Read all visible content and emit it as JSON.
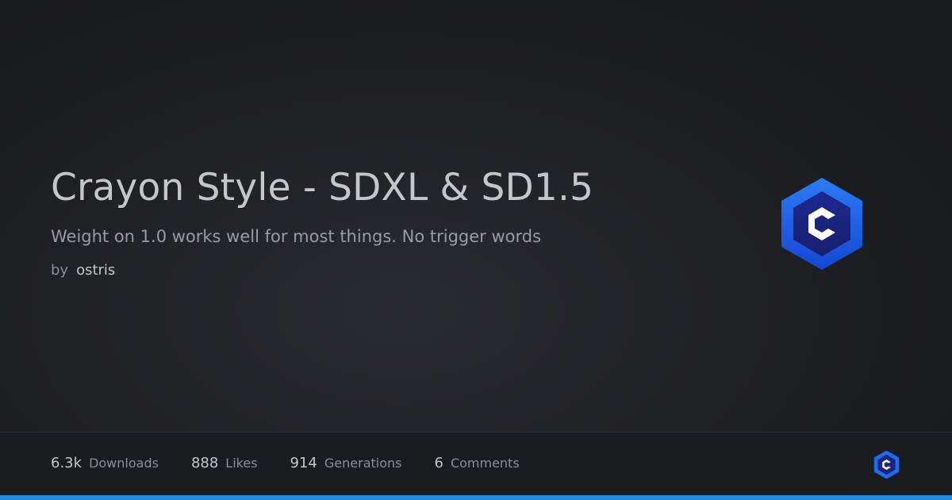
{
  "model": {
    "title": "Crayon Style - SDXL & SD1.5",
    "description": "Weight on 1.0 works well for most things. No trigger words",
    "by_label": "by",
    "author": "ostris"
  },
  "stats": [
    {
      "value": "6.3k",
      "label": "Downloads"
    },
    {
      "value": "888",
      "label": "Likes"
    },
    {
      "value": "914",
      "label": "Generations"
    },
    {
      "value": "6",
      "label": "Comments"
    }
  ],
  "brand": {
    "logo_icon": "civitai-logo-icon",
    "logo_letter": "C",
    "accent_color": "#228be6",
    "logo_blue": "#1e6cf2",
    "logo_dark": "#1b237d"
  }
}
